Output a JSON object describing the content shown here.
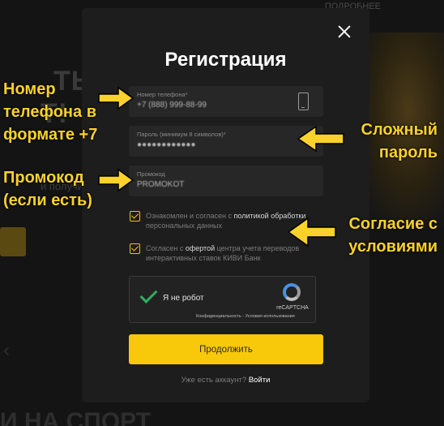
{
  "background": {
    "headline_line1": "ТЫСЯЧ",
    "headline_line2": "Т!",
    "subtext": "и получи нов",
    "top_link": "ПОДРОБНЕЕ",
    "bottom_text": "И НА СПОРТ"
  },
  "modal": {
    "title": "Регистрация",
    "phone": {
      "label": "Номер телефона*",
      "value": "+7 (888) 999-88-99"
    },
    "password": {
      "label": "Пароль (минимум 8 символов)*",
      "value": "●●●●●●●●●●●●"
    },
    "promo": {
      "label": "Промокод",
      "value": "PROMOKOT"
    },
    "consent_terms": {
      "prefix": "Ознакомлен и согласен с ",
      "link": "политикой обработки",
      "suffix": " персональных данных",
      "checked": true
    },
    "consent_offer": {
      "prefix": "Согласен с ",
      "link": "офертой",
      "suffix": " центра учета переводов интерактивных ставок КИВИ Банк",
      "checked": true
    },
    "captcha": {
      "label": "Я не робот",
      "brand": "reCAPTCHA",
      "links": "Конфиденциальность - Условия использования"
    },
    "submit_label": "Продолжить",
    "login_question": "Уже есть аккаунт?",
    "login_link": "Войти"
  },
  "annotations": {
    "phone_line1": "Номер",
    "phone_line2": "телефона в",
    "phone_line3": "формате +7",
    "password_line1": "Сложный",
    "password_line2": "пароль",
    "promo_line1": "Промокод",
    "promo_line2": "(если есть)",
    "terms_line1": "Согласие с",
    "terms_line2": "условиями"
  },
  "colors": {
    "accent_yellow": "#f8c80a",
    "annotation_yellow": "#fbd22b",
    "modal_bg": "#1d1d1d",
    "checkmark_green": "#2eae5f"
  },
  "icons": [
    "close-icon",
    "phone-icon",
    "checkbox-checked-icon",
    "recaptcha-icon",
    "arrow-right-icon",
    "arrow-left-icon"
  ]
}
